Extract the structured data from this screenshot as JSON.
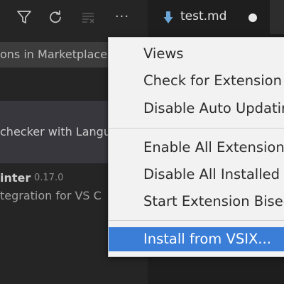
{
  "sidebar": {
    "toolbar": {
      "filter_icon": "filter-icon",
      "refresh_icon": "refresh-icon",
      "clear_icon": "clear-results-icon",
      "more_label": "···"
    },
    "search": {
      "value": "ons in Marketplace"
    },
    "extensions": [
      {
        "description": "checker with Langu"
      },
      {
        "name": "inter",
        "version": "0.17.0",
        "description": "tegration for VS C"
      }
    ]
  },
  "editor": {
    "tab": {
      "label": "test.md",
      "icon": "markdown-arrow-icon",
      "dirty_indicator": "dot"
    }
  },
  "context_menu": {
    "groups": [
      [
        "Views",
        "Check for Extension U",
        "Disable Auto Updatin"
      ],
      [
        "Enable All Extension",
        "Disable All Installed E",
        "Start Extension Bisec"
      ],
      [
        "Install from VSIX..."
      ]
    ],
    "highlighted": "Install from VSIX..."
  },
  "colors": {
    "menu_highlight": "#3a7ed8",
    "tab_icon": "#6aa6d8",
    "sidebar_bg": "#252526",
    "editor_bg": "#1e1e1e"
  }
}
